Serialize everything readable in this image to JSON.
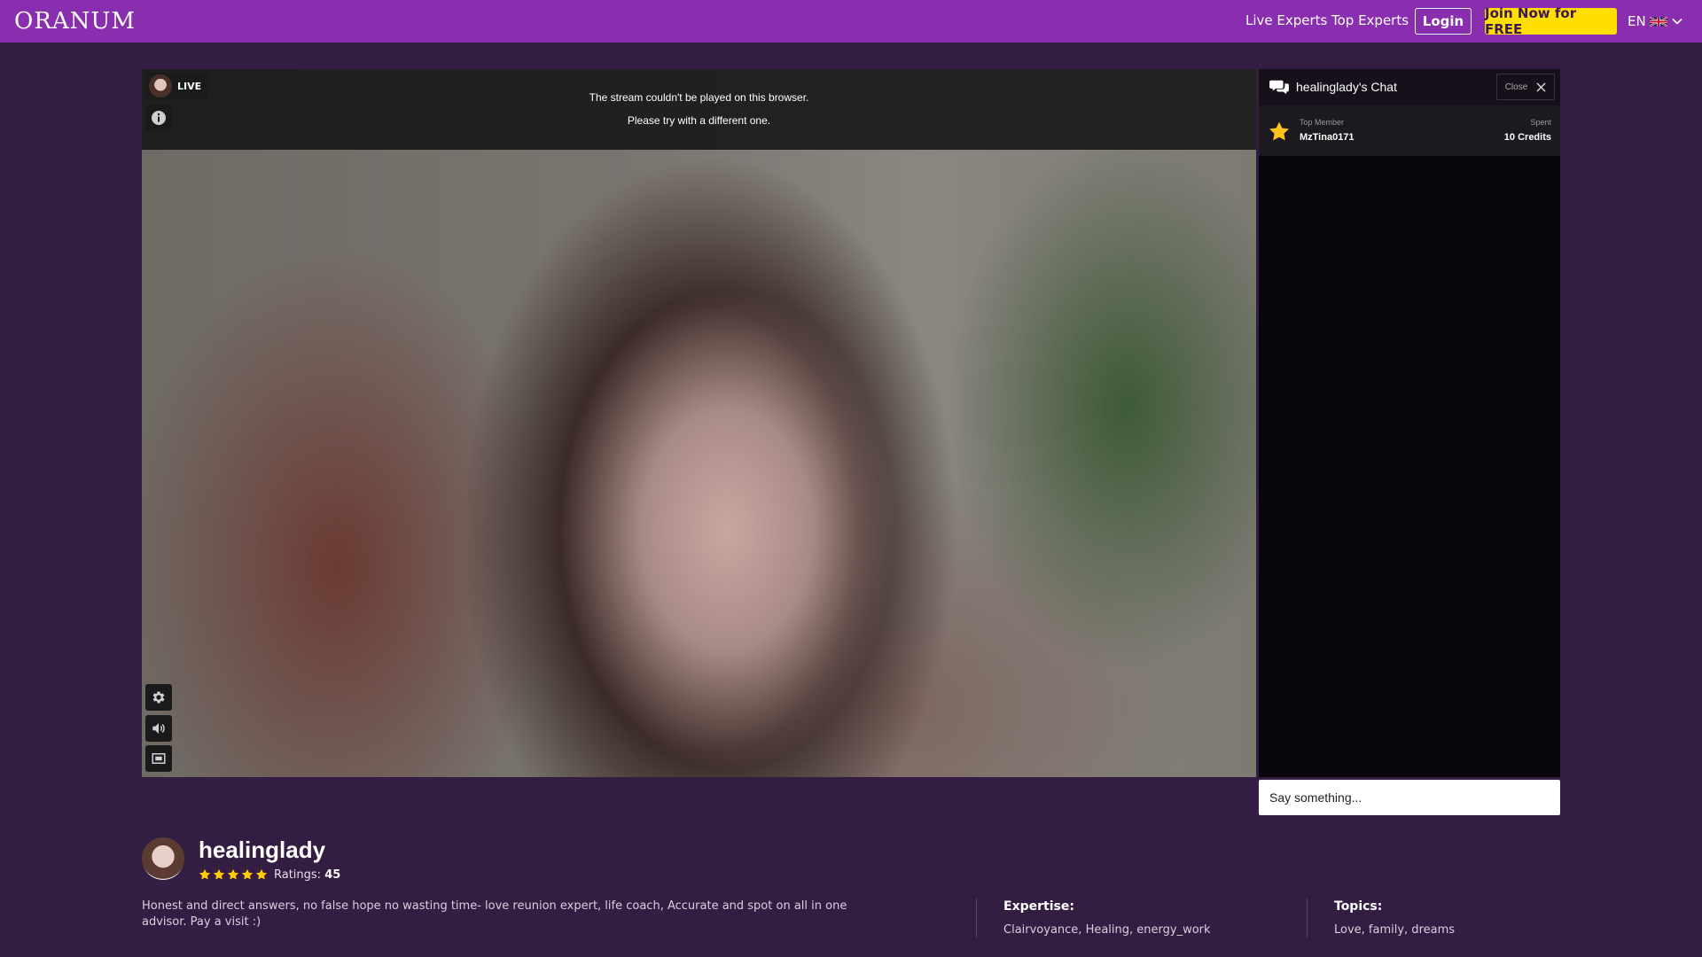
{
  "header": {
    "logo": "ORANUM",
    "nav": {
      "live_experts": "Live Experts",
      "top_experts": "Top Experts",
      "login": "Login",
      "join": "Join Now for FREE",
      "language": "EN"
    }
  },
  "video": {
    "live_label": "LIVE",
    "message_line1": "The stream couldn't be played on this browser.",
    "message_line2": "Please try with a different one."
  },
  "chat": {
    "title": "healinglady's Chat",
    "close_label": "Close",
    "top_member_label": "Top Member",
    "top_member_name": "MzTina0171",
    "spent_label": "Spent",
    "spent_value": "10 Credits",
    "input_placeholder": "Say something..."
  },
  "profile": {
    "name": "healinglady",
    "ratings_label": "Ratings:",
    "ratings_count": "45",
    "stars": 5,
    "description": "Honest and direct answers, no false hope no wasting time- love reunion expert, life coach, Accurate and spot on all in one advisor. Pay a visit :)",
    "expertise_title": "Expertise:",
    "expertise_value": "Clairvoyance, Healing, energy_work",
    "topics_title": "Topics:",
    "topics_value": "Love, family, dreams"
  },
  "colors": {
    "header_bg": "#8a2eb0",
    "page_bg": "#331d42",
    "join_button": "#ffde00",
    "star": "#ffcc00"
  }
}
